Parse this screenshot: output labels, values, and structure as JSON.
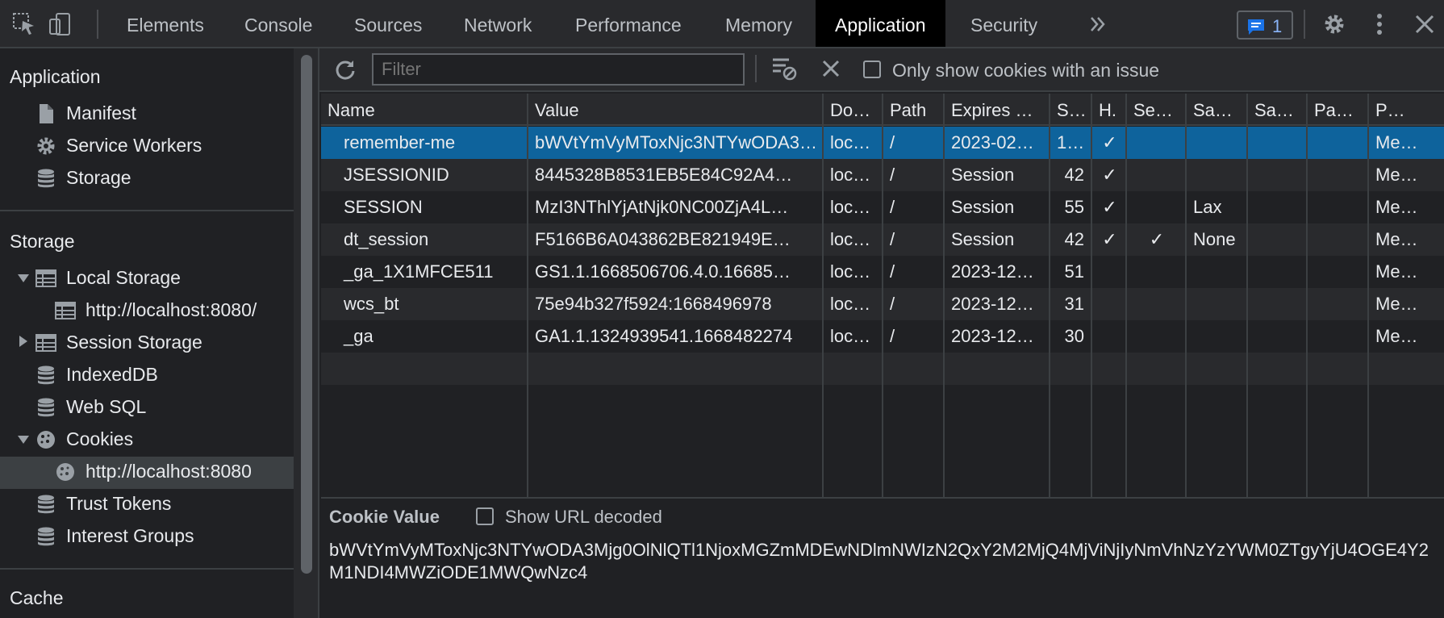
{
  "tabs": [
    {
      "label": "Elements"
    },
    {
      "label": "Console"
    },
    {
      "label": "Sources"
    },
    {
      "label": "Network"
    },
    {
      "label": "Performance"
    },
    {
      "label": "Memory"
    },
    {
      "label": "Application",
      "active": true
    },
    {
      "label": "Security"
    }
  ],
  "more_tabs_icon": "chevron-double-right-icon",
  "issues_badge": {
    "count": "1"
  },
  "sidebar": {
    "application_heading": "Application",
    "application_items": [
      {
        "label": "Manifest",
        "icon": "file-icon"
      },
      {
        "label": "Service Workers",
        "icon": "gear-icon"
      },
      {
        "label": "Storage",
        "icon": "database-icon"
      }
    ],
    "storage_heading": "Storage",
    "storage_items": {
      "local_storage": "Local Storage",
      "local_storage_child": "http://localhost:8080/",
      "session_storage": "Session Storage",
      "indexeddb": "IndexedDB",
      "websql": "Web SQL",
      "cookies": "Cookies",
      "cookies_child": "http://localhost:8080",
      "trust_tokens": "Trust Tokens",
      "interest_groups": "Interest Groups"
    },
    "cache_heading": "Cache"
  },
  "toolbar": {
    "filter_placeholder": "Filter",
    "only_issue_label": "Only show cookies with an issue"
  },
  "table": {
    "headers": [
      "Name",
      "Value",
      "Do…",
      "Path",
      "Expires …",
      "S…",
      "H.",
      "Se…",
      "Sa…",
      "Sa…",
      "Pa…",
      "P…"
    ],
    "rows": [
      [
        "remember-me",
        "bWVtYmVyMToxNjc3NTYwODA3Mjg0OlNlQTl1NjoxMGZmMDEwNDlmNWIzN2QxY2M2MjQ4MjViNjIyNmVhNzYzYWM0ZTgyYjU4OGE4Y2M1NDI4MWZiODE1MWQwNzc4",
        "loc…",
        "/",
        "2023-02…",
        "1…",
        "✓",
        "",
        "",
        "",
        "",
        "Me…"
      ],
      [
        "JSESSIONID",
        "8445328B8531EB5E84C92A4…",
        "loc…",
        "/",
        "Session",
        "42",
        "✓",
        "",
        "",
        "",
        "",
        "Me…"
      ],
      [
        "SESSION",
        "MzI3NThlYjAtNjk0NC00ZjA4L…",
        "loc…",
        "/",
        "Session",
        "55",
        "✓",
        "",
        "Lax",
        "",
        "",
        "Me…"
      ],
      [
        "dt_session",
        "F5166B6A043862BE821949E…",
        "loc…",
        "/",
        "Session",
        "42",
        "✓",
        "✓",
        "None",
        "",
        "",
        "Me…"
      ],
      [
        "_ga_1X1MFCE511",
        "GS1.1.1668506706.4.0.16685…",
        "loc…",
        "/",
        "2023-12…",
        "51",
        "",
        "",
        "",
        "",
        "",
        "Me…"
      ],
      [
        "wcs_bt",
        "75e94b327f5924:1668496978",
        "loc…",
        "/",
        "2023-12…",
        "31",
        "",
        "",
        "",
        "",
        "",
        "Me…"
      ],
      [
        "_ga",
        "GA1.1.1324939541.1668482274",
        "loc…",
        "/",
        "2023-12…",
        "30",
        "",
        "",
        "",
        "",
        "",
        "Me…"
      ]
    ]
  },
  "cookie_panel": {
    "title": "Cookie Value",
    "show_decoded_label": "Show URL decoded",
    "value": "bWVtYmVyMToxNjc3NTYwODA3Mjg0OlNlQTl1NjoxMGZmMDEwNDlmNWIzN2QxY2M2MjQ4MjViNjIyNmVhNzYzYWM0ZTgyYjU4OGE4Y2M1NDI4MWZiODE1MWQwNzc4"
  },
  "colors": {
    "selected_row": "#0e639c",
    "active_tab": "#000000",
    "badge_icon": "#1a73e8"
  }
}
